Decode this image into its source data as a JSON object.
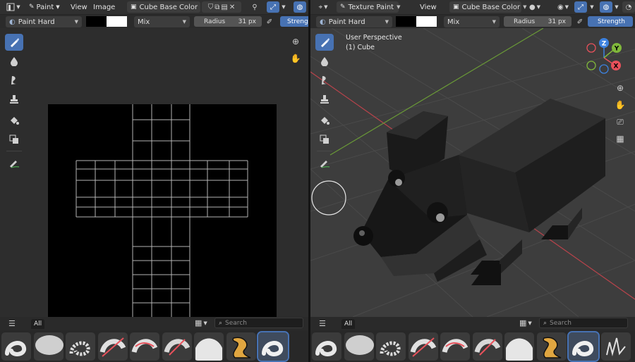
{
  "left_editor": {
    "menus": [
      "Paint",
      "View",
      "Image"
    ],
    "image_name": "Cube Base Color",
    "brush_name": "Paint Hard",
    "blend_mode": "Mix",
    "radius_label": "Radius",
    "radius_value": "31 px",
    "strength_label": "Strengt",
    "colors": {
      "primary": "#000000",
      "secondary": "#ffffff"
    },
    "shelf": {
      "tab": "All",
      "search_placeholder": "Search"
    }
  },
  "right_editor": {
    "mode": "Texture Paint",
    "menus": [
      "View"
    ],
    "image_name": "Cube Base Color",
    "brush_name": "Paint Hard",
    "blend_mode": "Mix",
    "radius_label": "Radius",
    "radius_value": "31 px",
    "strength_label": "Strength",
    "colors": {
      "primary": "#000000",
      "secondary": "#ffffff"
    },
    "viewport": {
      "perspective": "User Perspective",
      "object": "(1) Cube"
    },
    "gizmo": {
      "x": "X",
      "y": "Y",
      "z": "Z"
    },
    "shelf": {
      "tab": "All",
      "search_placeholder": "Search"
    }
  },
  "theme": {
    "accent": "#4772b3",
    "header": "#303030",
    "viewport": "#3d3d3d",
    "x_axis": "#e8515b",
    "y_axis": "#80b83b",
    "z_axis": "#3d82e0"
  }
}
